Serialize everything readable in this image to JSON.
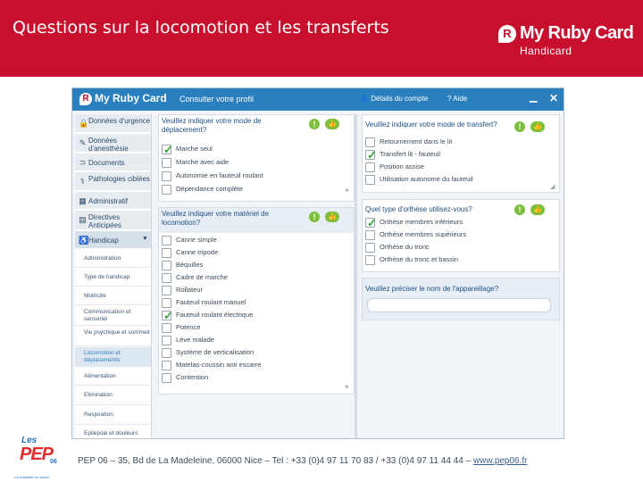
{
  "slide": {
    "title": "Questions sur la locomotion et les transferts",
    "brand": {
      "badge": "R",
      "name": "My Ruby Card",
      "sub": "Handicard"
    }
  },
  "app": {
    "topbar": {
      "badge": "R",
      "brand": "My Ruby Card",
      "profile": "Consulter votre profil",
      "account": "Détails du compte",
      "help": "Aide"
    },
    "sidebar": {
      "items": [
        {
          "icon": "lock-icon",
          "glyph": "🔒",
          "label": "Données d'urgence"
        },
        {
          "icon": "syringe-icon",
          "glyph": "✎",
          "label": "Données d'anesthésie"
        },
        {
          "icon": "documents-icon",
          "glyph": "⊃",
          "label": "Documents"
        },
        {
          "icon": "pathology-icon",
          "glyph": "⚕",
          "label": "Pathologies ciblées"
        },
        {
          "icon": "admin-icon",
          "glyph": "▦",
          "label": "Administratif"
        },
        {
          "icon": "directives-icon",
          "glyph": "▤",
          "label": "Directives Anticipées"
        },
        {
          "icon": "wheelchair-icon",
          "glyph": "♿",
          "label": "Handicap"
        }
      ],
      "subitems": [
        "Administration",
        "Type de handicap",
        "Motricité",
        "Communication et sensoriel",
        "Vie psychique et sommeil",
        "Locomotion et déplacements",
        "Alimentation",
        "Elimination",
        "Respiration",
        "Epilepsie et douleurs"
      ],
      "active_subitem": "Locomotion et déplacements"
    },
    "panels": {
      "deplacement": {
        "question": "Veuillez indiquer votre mode de déplacement?",
        "options": [
          {
            "label": "Marche seul",
            "checked": true
          },
          {
            "label": "Marche avec aide",
            "checked": false
          },
          {
            "label": "Autonomie en fauteuil roulant",
            "checked": false
          },
          {
            "label": "Dépendance complète",
            "checked": false
          }
        ]
      },
      "transfert": {
        "question": "Veuillez indiquer votre mode de transfert?",
        "options": [
          {
            "label": "Retournement dans le lit",
            "checked": false
          },
          {
            "label": "Transfert lit - fauteuil",
            "checked": true
          },
          {
            "label": "Position assise",
            "checked": false
          },
          {
            "label": "Utilisation autonome du fauteuil",
            "checked": false
          }
        ]
      },
      "materiel": {
        "question": "Veuillez indiquer votre matériel de locomotion?",
        "options": [
          {
            "label": "Canne simple",
            "checked": false
          },
          {
            "label": "Canne tripode",
            "checked": false
          },
          {
            "label": "Béquilles",
            "checked": false
          },
          {
            "label": "Cadre de marche",
            "checked": false
          },
          {
            "label": "Rollateur",
            "checked": false
          },
          {
            "label": "Fauteuil roulant manuel",
            "checked": false
          },
          {
            "label": "Fauteuil roulant électrique",
            "checked": true
          },
          {
            "label": "Potence",
            "checked": false
          },
          {
            "label": "Lève malade",
            "checked": false
          },
          {
            "label": "Système de verticalisation",
            "checked": false
          },
          {
            "label": "Matelas-coussin anti escarre",
            "checked": false
          },
          {
            "label": "Contention",
            "checked": false
          }
        ]
      },
      "orthese": {
        "question": "Quel type d'orthèse utilisez-vous?",
        "options": [
          {
            "label": "Orthèse membres inférieurs",
            "checked": true
          },
          {
            "label": "Orthèse membres supérieurs",
            "checked": false
          },
          {
            "label": "Orthèse du tronc",
            "checked": false
          },
          {
            "label": "Orthèse du tronc et bassin",
            "checked": false
          }
        ]
      },
      "appareillage": {
        "question": "Veuillez préciser le nom de l'appareillage?",
        "value": ""
      }
    }
  },
  "footer": {
    "logo": {
      "les": "Les",
      "pep": "PEP",
      "num": "06",
      "tag": "La solidarité en action"
    },
    "text": "PEP 06 – 35, Bd de La Madeleine, 06000 Nice – Tel : +33 (0)4 97 11 70 83 / +33 (0)4 97 11 44 44 – ",
    "link": "www.pep06.fr"
  },
  "colors": {
    "banner": "#c8102e",
    "topbar": "#2a7fbe",
    "accent_green": "#7cbf3a",
    "question_text": "#1e4f82"
  }
}
